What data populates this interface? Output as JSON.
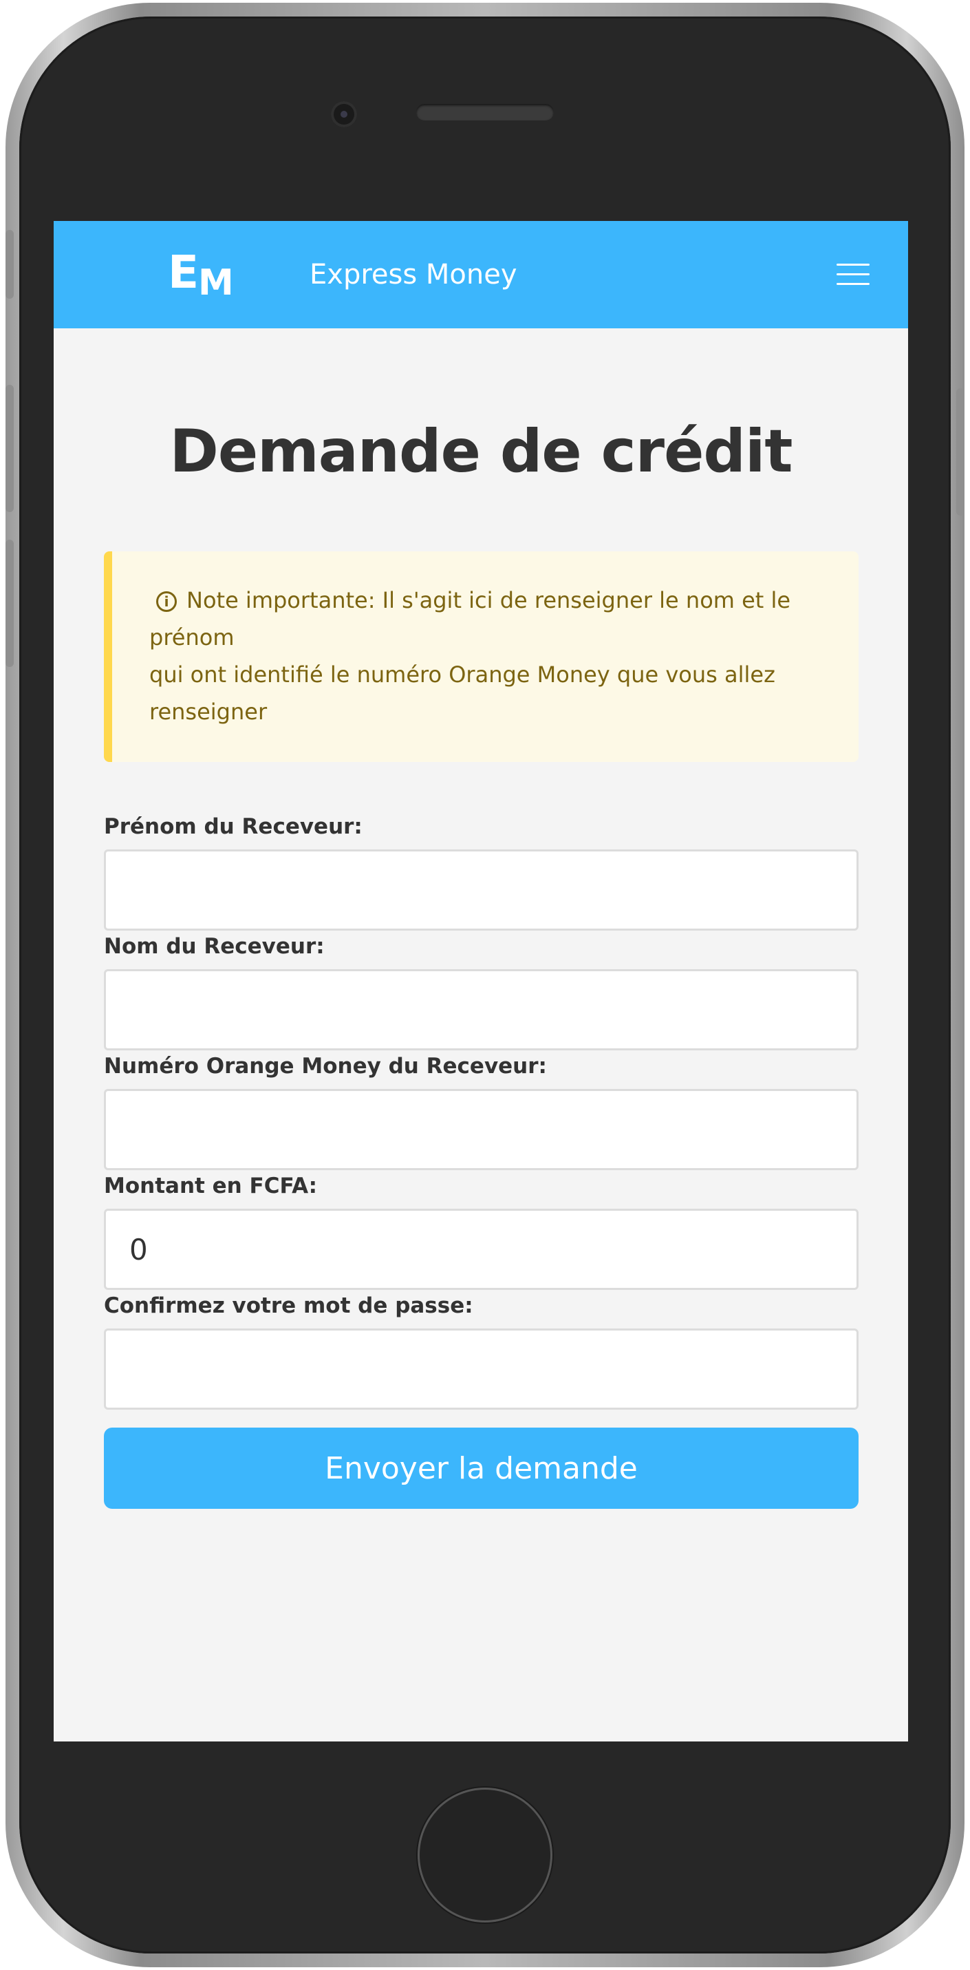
{
  "navbar": {
    "logo_e": "E",
    "logo_m": "M",
    "brand": "Express Money",
    "menu_icon": "hamburger-menu-icon"
  },
  "page": {
    "title": "Demande de crédit"
  },
  "notice": {
    "icon": "info-circle-icon",
    "icon_glyph": "i",
    "line1": "Note importante: Il s'agit ici de renseigner le nom et le prénom",
    "line2": "qui ont identifié le numéro Orange Money que vous allez renseigner"
  },
  "form": {
    "receiver_firstname": {
      "label": "Prénom du Receveur:",
      "value": ""
    },
    "receiver_lastname": {
      "label": "Nom du Receveur:",
      "value": ""
    },
    "receiver_phone": {
      "label": "Numéro Orange Money du Receveur:",
      "value": ""
    },
    "amount": {
      "label": "Montant en FCFA:",
      "value": "0"
    },
    "password": {
      "label": "Confirmez votre mot de passe:",
      "value": ""
    },
    "submit_label": "Envoyer la demande"
  },
  "colors": {
    "primary": "#3cb6fc",
    "notice_bg": "#fdf9e6",
    "notice_border": "#ffd84d",
    "notice_text": "#7c6411",
    "title_text": "#333333"
  }
}
